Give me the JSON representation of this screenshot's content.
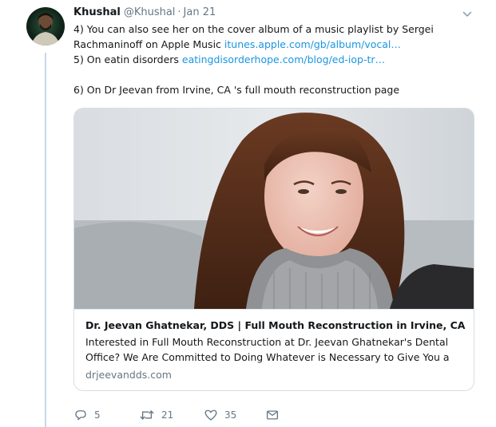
{
  "tweet": {
    "author_name": "Khushal",
    "author_handle": "@Khushal",
    "separator": "·",
    "timestamp": "Jan 21",
    "line1": "4) You can also see her on the cover album of a music playlist by Sergei",
    "line2_text": "Rachmaninoff on Apple Music ",
    "line2_link": "itunes.apple.com/gb/album/vocal…",
    "line3_text": "5) On eatin disorders ",
    "line3_link": "eatingdisorderhope.com/blog/ed-iop-tr…",
    "line5": "6) On Dr Jeevan from Irvine, CA 's full mouth reconstruction page"
  },
  "card": {
    "title": "Dr. Jeevan Ghatnekar, DDS | Full Mouth Reconstruction in Irvine, CA",
    "description_line1": "Interested in Full Mouth Reconstruction at Dr. Jeevan Ghatnekar's Dental",
    "description_line2": "Office? We Are Committed to Doing Whatever is Necessary to Give You a",
    "domain": "drjeevandds.com"
  },
  "actions": {
    "reply_count": "5",
    "retweet_count": "21",
    "like_count": "35"
  },
  "icons": {
    "reply": "reply-icon",
    "retweet": "retweet-icon",
    "like": "heart-icon",
    "dm": "envelope-icon",
    "menu": "chevron-down-icon"
  },
  "colors": {
    "link": "#1b95e0",
    "secondary_text": "#657786",
    "thread_line": "#c4d9ec"
  }
}
